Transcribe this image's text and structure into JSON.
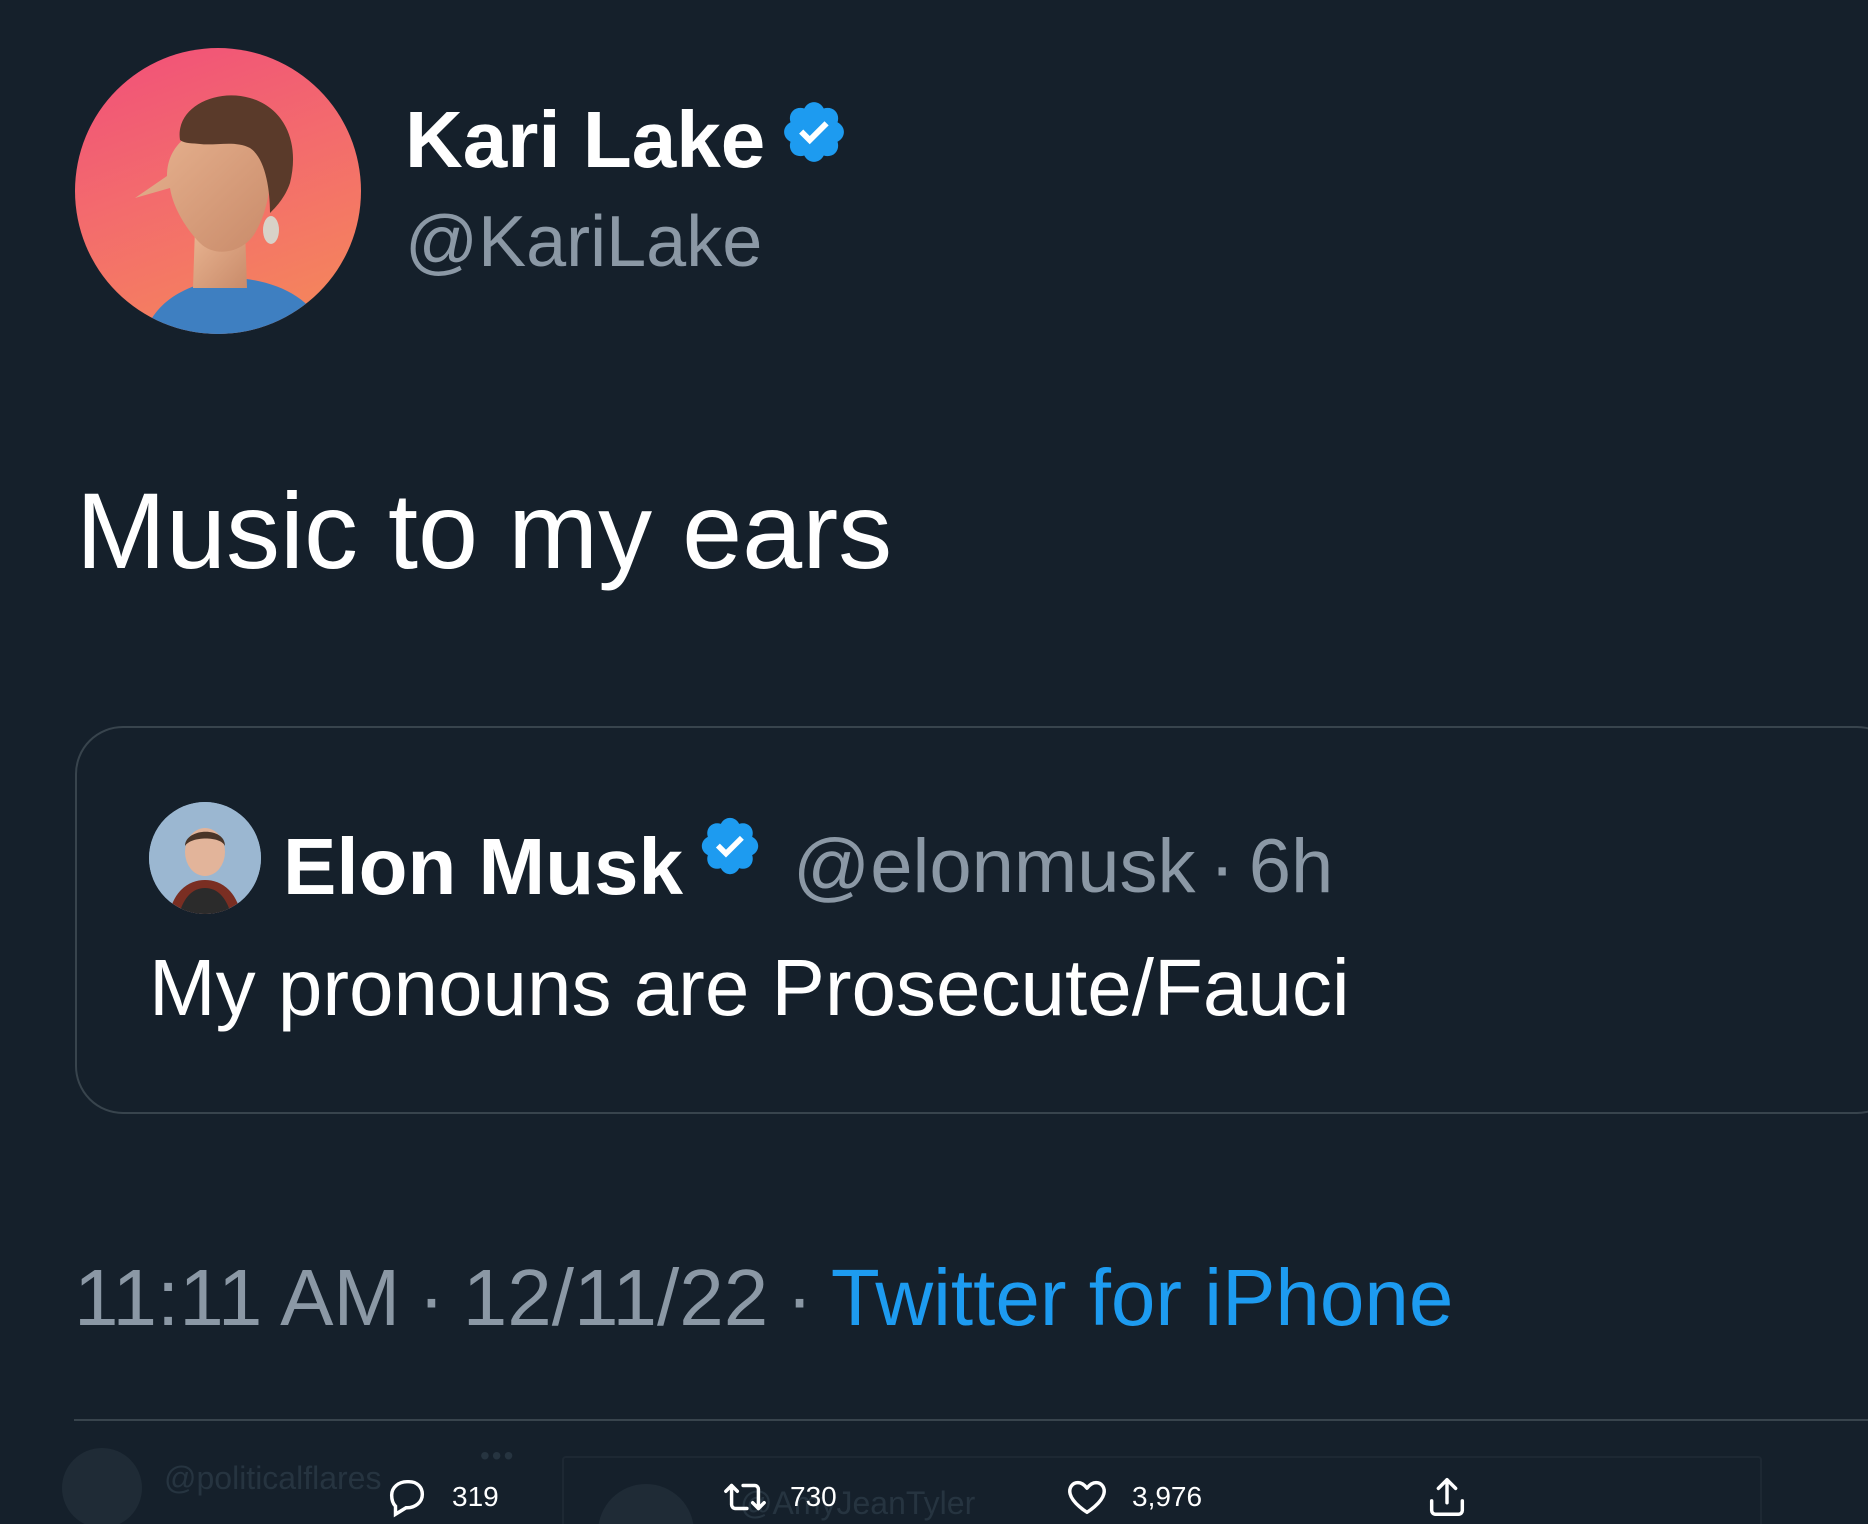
{
  "author": {
    "name": "Kari Lake",
    "handle": "@KariLake",
    "verified": true,
    "avatar_icon": "avatar-photo"
  },
  "tweet": {
    "text": "Music to my ears"
  },
  "quoted_tweet": {
    "author_name": "Elon Musk",
    "handle": "@elonmusk",
    "separator": "·",
    "time_ago": "6h",
    "text": "My pronouns are Prosecute/Fauci",
    "verified": true
  },
  "meta": {
    "time": "11:11 AM",
    "separator": "·",
    "date": "12/11/22",
    "source": "Twitter for iPhone"
  },
  "actions": {
    "reply_count": "319",
    "retweet_count": "730",
    "like_count": "3,976"
  },
  "background": {
    "watermark_handle": "@politicalflares",
    "ghost_text": "@AmyJeanTyler"
  },
  "colors": {
    "background": "#15202b",
    "verified_badge": "#1d9bf0",
    "link": "#1d9bf0",
    "secondary_text": "#8b98a5",
    "border": "#38444d"
  }
}
